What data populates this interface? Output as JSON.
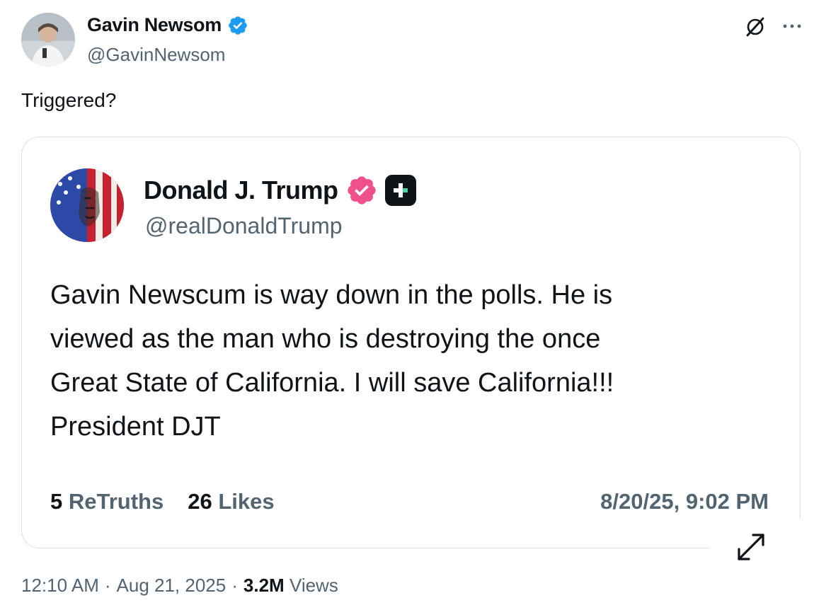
{
  "tweet": {
    "author": {
      "name": "Gavin Newsom",
      "handle": "@GavinNewsom",
      "avatar_icon": "gavin-newsom-avatar",
      "verified_color": "#1d9bf0"
    },
    "text": "Triggered?",
    "header_icons": [
      "grok-icon",
      "more-icon"
    ],
    "footer": {
      "time": "12:10 AM",
      "sep1": "·",
      "date": "Aug 21, 2025",
      "sep2": "·",
      "views_count": "3.2M",
      "views_label": "Views"
    }
  },
  "embed": {
    "author": {
      "name": "Donald J. Trump",
      "handle": "@realDonaldTrump",
      "avatar_icon": "trump-flag-avatar",
      "badge_color": "#f0508b"
    },
    "body_lines": [
      "Gavin Newscum is way down in the polls. He is",
      "viewed as the man who is destroying the once",
      "Great State of California. I will save California!!!",
      "President DJT"
    ],
    "stats": {
      "retruths_count": "5",
      "retruths_label": "ReTruths",
      "likes_count": "26",
      "likes_label": "Likes"
    },
    "timestamp": "8/20/25, 9:02 PM"
  },
  "colors": {
    "text_primary": "#0f1419",
    "text_secondary": "#536471",
    "border": "#dfe3e6"
  }
}
